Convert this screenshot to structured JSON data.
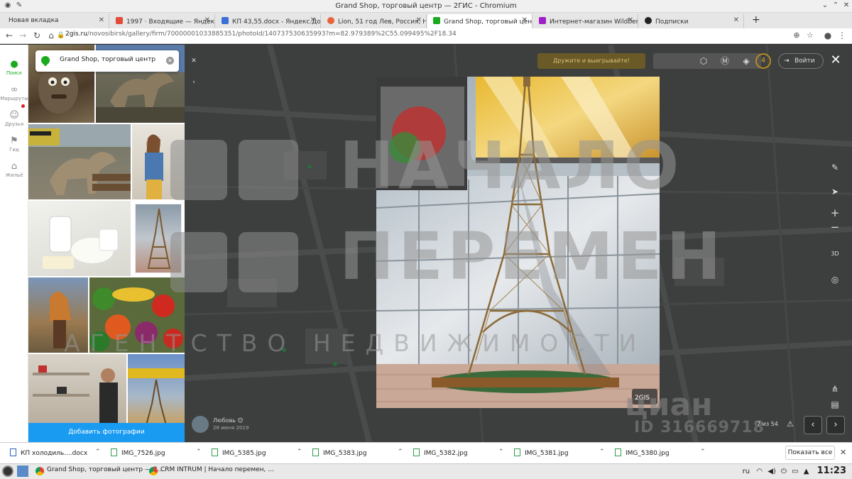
{
  "window": {
    "title": "Grand Shop, торговый центр — 2ГИС - Chromium"
  },
  "tabs": [
    {
      "label": "Новая вкладка",
      "color": "#4a8af4"
    },
    {
      "label": "1997 · Входящие — Яндекс.П",
      "color": "#e04b3a"
    },
    {
      "label": "КП 43,55.docx - Яндекс.Доку",
      "color": "#3b6fd8"
    },
    {
      "label": "Lion, 51 год Лев, Россия, Ног",
      "color": "#e8623a"
    },
    {
      "label": "Grand Shop, торговый центр",
      "color": "#19aa1e"
    },
    {
      "label": "Интернет-магазин Wildberri",
      "color": "#a01ec8"
    },
    {
      "label": "Подписки",
      "color": "#222222"
    }
  ],
  "address": {
    "domain": "2gis.ru",
    "path": "/novosibirsk/gallery/firm/70000001033885351/photoId/140737530635993?m=82.979389%2C55.099495%2F18.34"
  },
  "leftnav": [
    {
      "label": "Поиск",
      "icon": "pin-icon"
    },
    {
      "label": "Маршруты",
      "icon": "route-icon"
    },
    {
      "label": "Друзья",
      "icon": "friends-icon"
    },
    {
      "label": "Гид",
      "icon": "flag-icon"
    },
    {
      "label": "Жильё",
      "icon": "house-icon"
    }
  ],
  "search": {
    "title": "Grand Shop, торговый центр"
  },
  "gallery": {
    "add_photo": "Добавить фотографии"
  },
  "viewer": {
    "author": "Любовь 😊",
    "date": "28 июня 2019",
    "counter": "7 из 54",
    "close": "✕",
    "prev": "‹",
    "next": "›",
    "map_login": "Войти",
    "map_promo": "Дружите и выигрывайте!",
    "map_badge": "4"
  },
  "watermarks": {
    "line1": "НАЧАЛО",
    "line2": "ПЕРЕМЕН",
    "line3": "АГЕНТСТВО НЕДВИЖИМОСТИ",
    "cian": "циан",
    "cian_id": "ID 316669718",
    "photo_logo": "2GIS"
  },
  "downloads": [
    {
      "name": "КП холодиль....docx",
      "type": "doc"
    },
    {
      "name": "IMG_7526.jpg",
      "type": "img"
    },
    {
      "name": "IMG_5385.jpg",
      "type": "img"
    },
    {
      "name": "IMG_5383.jpg",
      "type": "img"
    },
    {
      "name": "IMG_5382.jpg",
      "type": "img"
    },
    {
      "name": "IMG_5381.jpg",
      "type": "img"
    },
    {
      "name": "IMG_5380.jpg",
      "type": "img"
    }
  ],
  "downloads_bar": {
    "show_all": "Показать все"
  },
  "taskbar": {
    "apps": [
      "Grand Shop, торговый центр — 2...",
      "CRM INTRUM | Начало перемен, ..."
    ],
    "lang": "ru",
    "time": "11:23"
  }
}
